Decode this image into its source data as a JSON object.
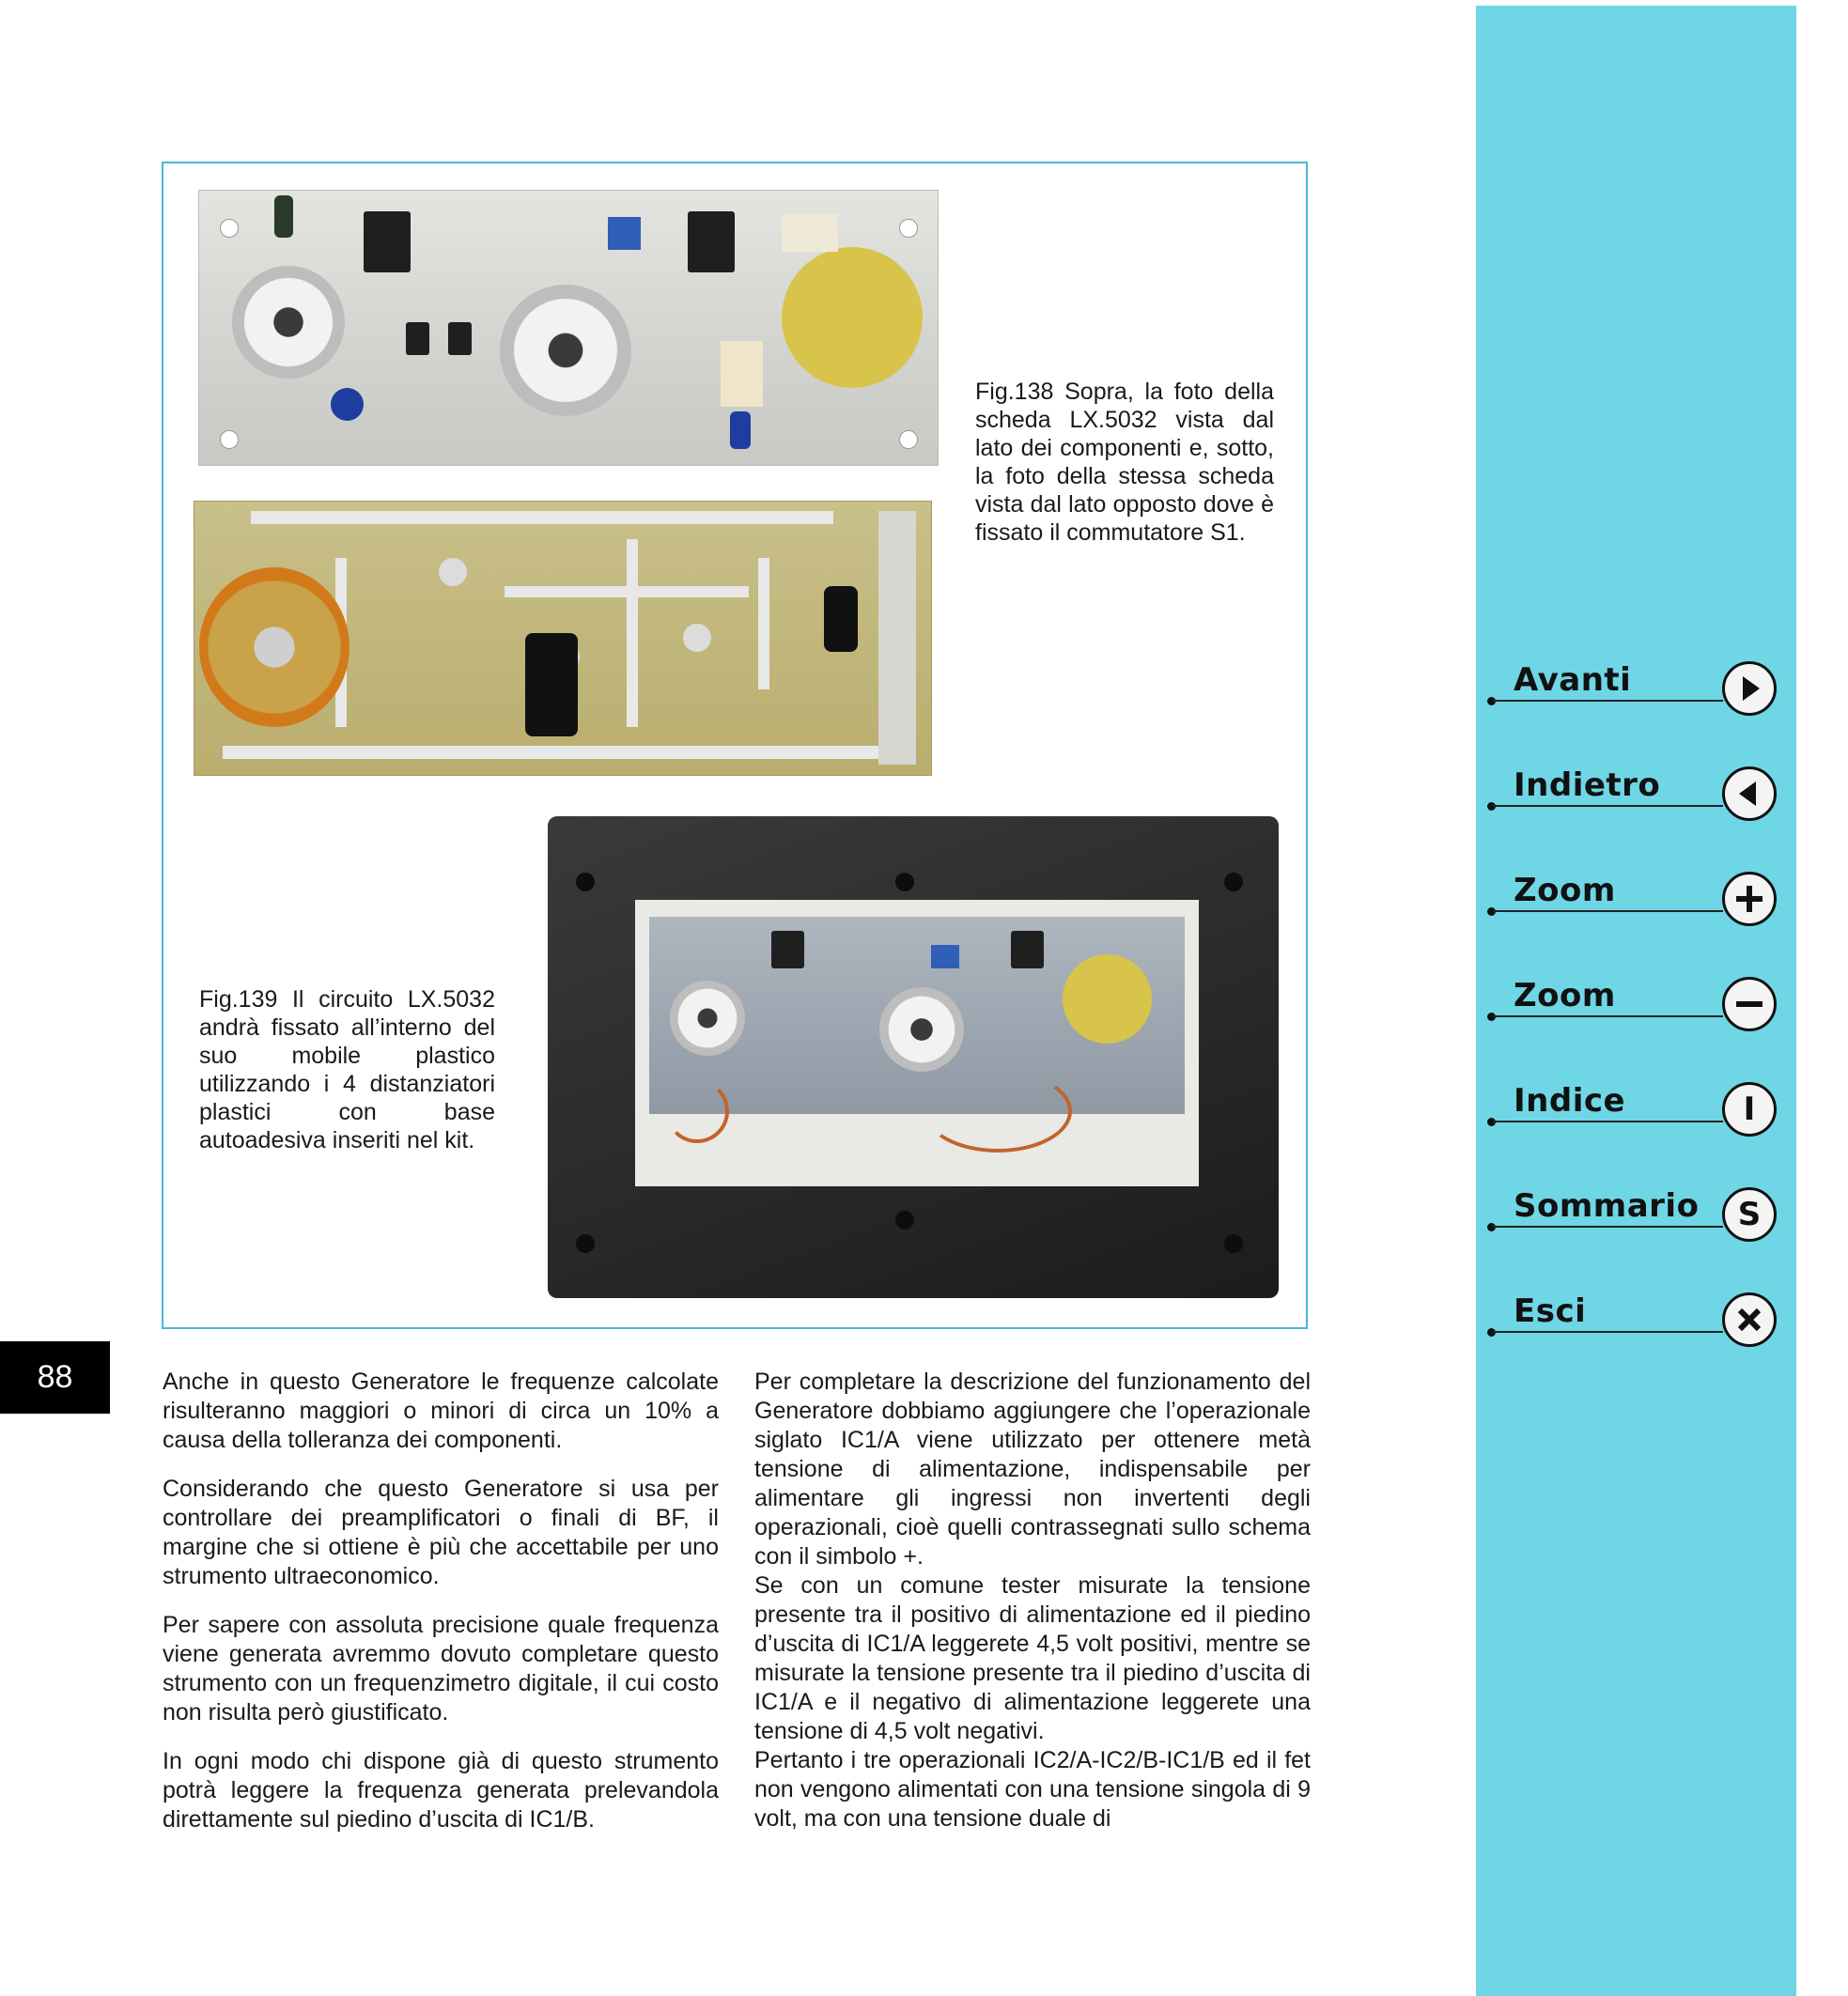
{
  "figures": {
    "fig138_caption": "Fig.138 Sopra, la foto della scheda LX.5032 vista dal lato dei componenti e, sotto, la foto della stessa scheda vista dal lato opposto dove è fissato il commutatore S1.",
    "fig139_caption": "Fig.139 Il circuito LX.5032 andrà fissato all’interno del suo mobile plastico utilizzando i 4 distanziatori plastici con base autoadesiva inseriti nel kit."
  },
  "page_number": "88",
  "body": {
    "left_column": [
      "Anche in questo Generatore le frequenze calcolate risulteranno maggiori o minori di circa un 10% a causa della tolleranza dei componenti.",
      "Considerando che questo Generatore si usa per controllare dei preamplificatori o finali di BF, il margine che si ottiene è più che accettabile per uno strumento ultraeconomico.",
      "Per sapere con assoluta precisione quale frequenza viene generata avremmo dovuto completare questo strumento con un frequenzimetro digitale, il cui costo non risulta però giustificato.",
      "In ogni modo chi dispone già di questo strumento potrà leggere la frequenza generata prelevandola direttamente sul piedino d’uscita di IC1/B."
    ],
    "right_column": [
      "Per completare la descrizione del funzionamento del Generatore dobbiamo aggiungere che l’operazionale siglato IC1/A viene utilizzato per ottenere metà tensione di alimentazione, indispensabile per alimentare gli ingressi non invertenti degli operazionali, cioè quelli contrassegnati sullo schema con il simbolo +.",
      "Se con un comune tester misurate la tensione presente tra il positivo di alimentazione ed il piedino d’uscita di IC1/A leggerete 4,5 volt positivi, mentre se misurate la tensione presente tra il piedino d’uscita di IC1/A e il negativo di alimentazione leggerete una tensione di 4,5 volt negativi.",
      "Pertanto i tre operazionali IC2/A-IC2/B-IC1/B ed il fet non vengono alimentati con una tensione singola di 9 volt, ma con una tensione duale di"
    ]
  },
  "nav": {
    "items": [
      {
        "label": "Avanti",
        "icon": "play-right-icon"
      },
      {
        "label": "Indietro",
        "icon": "play-left-icon"
      },
      {
        "label": "Zoom",
        "icon": "plus-icon"
      },
      {
        "label": "Zoom",
        "icon": "minus-icon"
      },
      {
        "label": "Indice",
        "icon": "index-icon",
        "glyph": "I"
      },
      {
        "label": "Sommario",
        "icon": "summary-icon",
        "glyph": "S"
      },
      {
        "label": "Esci",
        "icon": "close-icon"
      }
    ]
  },
  "colors": {
    "sidebar": "#6fd6e6",
    "frame_border": "#48b8d4",
    "page_number_bg": "#000000"
  }
}
